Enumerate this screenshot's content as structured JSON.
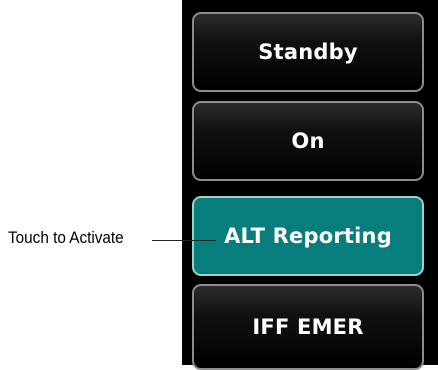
{
  "buttons": [
    {
      "label": "Standby",
      "state": "normal"
    },
    {
      "label": "On",
      "state": "normal"
    },
    {
      "label": "ALT Reporting",
      "state": "active"
    },
    {
      "label": "IFF EMER",
      "state": "normal"
    }
  ],
  "callout": {
    "text": "Touch to Activate"
  },
  "colors": {
    "active_fill": "#077d7c",
    "active_border": "#9ed0cc",
    "button_border": "#8c8c8c",
    "panel_background": "#000000"
  }
}
